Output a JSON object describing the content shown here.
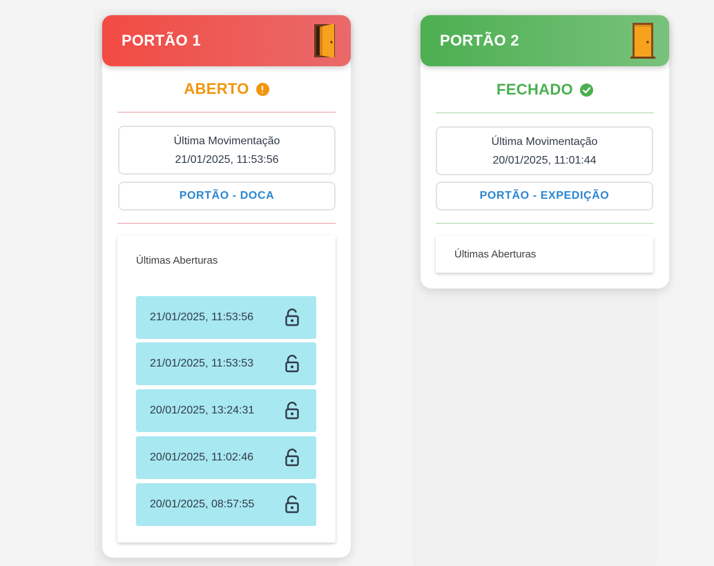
{
  "gates": [
    {
      "title": "PORTÃO 1",
      "status": "ABERTO",
      "status_color": "#f0960e",
      "header_colors": [
        "#f24b43",
        "#e96a6a"
      ],
      "divider_color": "#e8a0a4",
      "last_move_label": "Última Movimentação",
      "last_move_value": "21/01/2025, 11:53:56",
      "gate_name": "PORTÃO - DOCA",
      "history_title": "Últimas Aberturas",
      "history": [
        "21/01/2025, 11:53:56",
        "21/01/2025, 11:53:53",
        "20/01/2025, 13:24:31",
        "20/01/2025, 11:02:46",
        "20/01/2025, 08:57:55"
      ]
    },
    {
      "title": "PORTÃO 2",
      "status": "FECHADO",
      "status_color": "#4caf50",
      "header_colors": [
        "#4caf50",
        "#78c27c"
      ],
      "divider_color": "#a6d6a8",
      "last_move_label": "Última Movimentação",
      "last_move_value": "20/01/2025, 11:01:44",
      "gate_name": "PORTÃO - EXPEDIÇÃO",
      "history_title": "Últimas Aberturas",
      "history": []
    }
  ],
  "icons": {
    "gate1_door": "door-open-icon",
    "gate2_door": "door-closed-icon",
    "gate1_status": "alert-circle-icon",
    "gate2_status": "check-circle-icon",
    "history_item": "lock-open-icon"
  }
}
